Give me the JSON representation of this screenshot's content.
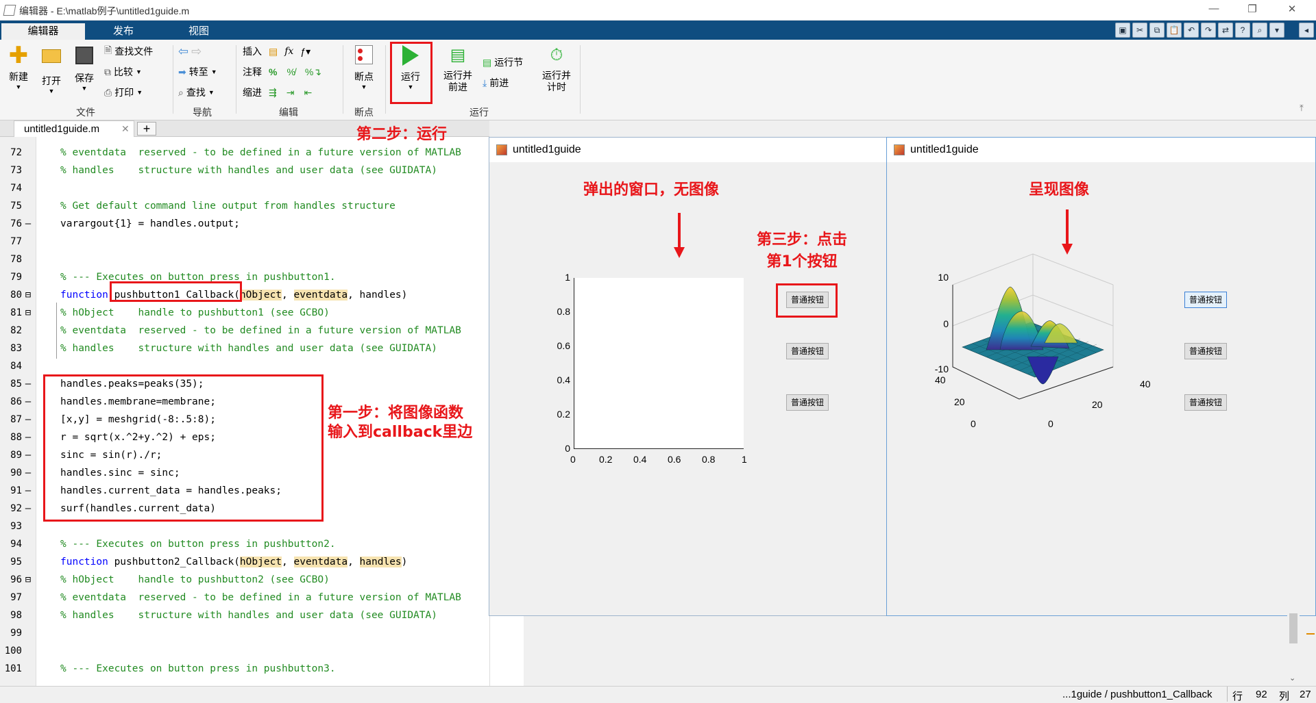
{
  "window": {
    "title": "编辑器 - E:\\matlab例子\\untitled1guide.m"
  },
  "tabs": [
    "编辑器",
    "发布",
    "视图"
  ],
  "ribbon": {
    "new": "新建",
    "open": "打开",
    "save": "保存",
    "find_files": "查找文件",
    "compare": "比较",
    "print": "打印",
    "goto": "转至",
    "find": "查找",
    "insert": "插入",
    "comment": "注释",
    "indent": "缩进",
    "breakpoints": "断点",
    "run": "运行",
    "run_advance": "运行并\n前进",
    "run_section": "运行节",
    "advance": "前进",
    "run_time": "运行并\n计时",
    "groups": {
      "file": "文件",
      "navigate": "导航",
      "edit": "编辑",
      "breakpoints": "断点",
      "run": "运行"
    }
  },
  "doc_tab": {
    "name": "untitled1guide.m"
  },
  "code_lines": [
    {
      "n": "72",
      "mark": "",
      "text": "% eventdata  reserved - to be defined in a future version of MATLAB",
      "type": "cm"
    },
    {
      "n": "73",
      "mark": "",
      "text": "% handles    structure with handles and user data (see GUIDATA)",
      "type": "cm"
    },
    {
      "n": "74",
      "mark": "",
      "text": "",
      "type": "code"
    },
    {
      "n": "75",
      "mark": "",
      "text": "% Get default command line output from handles structure",
      "type": "cm"
    },
    {
      "n": "76",
      "mark": "—",
      "text": "varargout{1} = handles.output;",
      "type": "code"
    },
    {
      "n": "77",
      "mark": "",
      "text": "",
      "type": "code"
    },
    {
      "n": "78",
      "mark": "",
      "text": "",
      "type": "code"
    },
    {
      "n": "79",
      "mark": "",
      "text": "% --- Executes on button press in pushbutton1.",
      "type": "cm"
    },
    {
      "n": "80",
      "mark": "⊟",
      "text": "",
      "type": "fn1"
    },
    {
      "n": "81",
      "mark": "⊟",
      "text": "% hObject    handle to pushbutton1 (see GCBO)",
      "type": "cm"
    },
    {
      "n": "82",
      "mark": "",
      "text": "% eventdata  reserved - to be defined in a future version of MATLAB",
      "type": "cm"
    },
    {
      "n": "83",
      "mark": "",
      "text": "% handles    structure with handles and user data (see GUIDATA)",
      "type": "cm"
    },
    {
      "n": "84",
      "mark": "",
      "text": "",
      "type": "code"
    },
    {
      "n": "85",
      "mark": "—",
      "text": "handles.peaks=peaks(35);",
      "type": "code"
    },
    {
      "n": "86",
      "mark": "—",
      "text": "handles.membrane=membrane;",
      "type": "code"
    },
    {
      "n": "87",
      "mark": "—",
      "text": "[x,y] = meshgrid(-8:.5:8);",
      "type": "code"
    },
    {
      "n": "88",
      "mark": "—",
      "text": "r = sqrt(x.^2+y.^2) + eps;",
      "type": "code"
    },
    {
      "n": "89",
      "mark": "—",
      "text": "sinc = sin(r)./r;",
      "type": "code"
    },
    {
      "n": "90",
      "mark": "—",
      "text": "handles.sinc = sinc;",
      "type": "code"
    },
    {
      "n": "91",
      "mark": "—",
      "text": "handles.current_data = handles.peaks;",
      "type": "code"
    },
    {
      "n": "92",
      "mark": "—",
      "text": "surf(handles.current_data)",
      "type": "code"
    },
    {
      "n": "93",
      "mark": "",
      "text": "",
      "type": "code"
    },
    {
      "n": "94",
      "mark": "",
      "text": "% --- Executes on button press in pushbutton2.",
      "type": "cm"
    },
    {
      "n": "95",
      "mark": "",
      "text": "",
      "type": "fn2"
    },
    {
      "n": "96",
      "mark": "⊟",
      "text": "% hObject    handle to pushbutton2 (see GCBO)",
      "type": "cm"
    },
    {
      "n": "97",
      "mark": "",
      "text": "% eventdata  reserved - to be defined in a future version of MATLAB",
      "type": "cm"
    },
    {
      "n": "98",
      "mark": "",
      "text": "% handles    structure with handles and user data (see GUIDATA)",
      "type": "cm"
    },
    {
      "n": "99",
      "mark": "",
      "text": "",
      "type": "code"
    },
    {
      "n": "100",
      "mark": "",
      "text": "",
      "type": "code"
    },
    {
      "n": "101",
      "mark": "",
      "text": "% --- Executes on button press in pushbutton3.",
      "type": "cm"
    }
  ],
  "fn1": {
    "kw": "function",
    "name": "pushbutton1_Callback",
    "a1": "hObject",
    "a2": "eventdata",
    "a3": "handles"
  },
  "fn2": {
    "kw": "function",
    "name": "pushbutton2_Callback",
    "a1": "hObject",
    "a2": "eventdata",
    "a3": "handles"
  },
  "annotations": {
    "step1_line1": "第一步：将图像函数",
    "step1_line2": "输入到callback里边",
    "step2": "第二步：运行",
    "popup": "弹出的窗口，无图像",
    "step3_line1": "第三步：点击",
    "step3_line2": "第1个按钮",
    "shown": "呈现图像"
  },
  "figure1": {
    "title": "untitled1guide",
    "yticks": [
      "1",
      "0.8",
      "0.6",
      "0.4",
      "0.2",
      "0"
    ],
    "xticks": [
      "0",
      "0.2",
      "0.4",
      "0.6",
      "0.8",
      "1"
    ],
    "buttons": [
      "普通按钮",
      "普通按钮",
      "普通按钮"
    ]
  },
  "figure2": {
    "title": "untitled1guide",
    "zticks": [
      "10",
      "0",
      "-10"
    ],
    "yticks": [
      "40",
      "20",
      "0"
    ],
    "xticks": [
      "0",
      "20",
      "40"
    ],
    "buttons": [
      "普通按钮",
      "普通按钮",
      "普通按钮"
    ]
  },
  "status": {
    "path": "...1guide / pushbutton1_Callback",
    "row_label": "行",
    "row": "92",
    "col_label": "列",
    "col": "27"
  }
}
